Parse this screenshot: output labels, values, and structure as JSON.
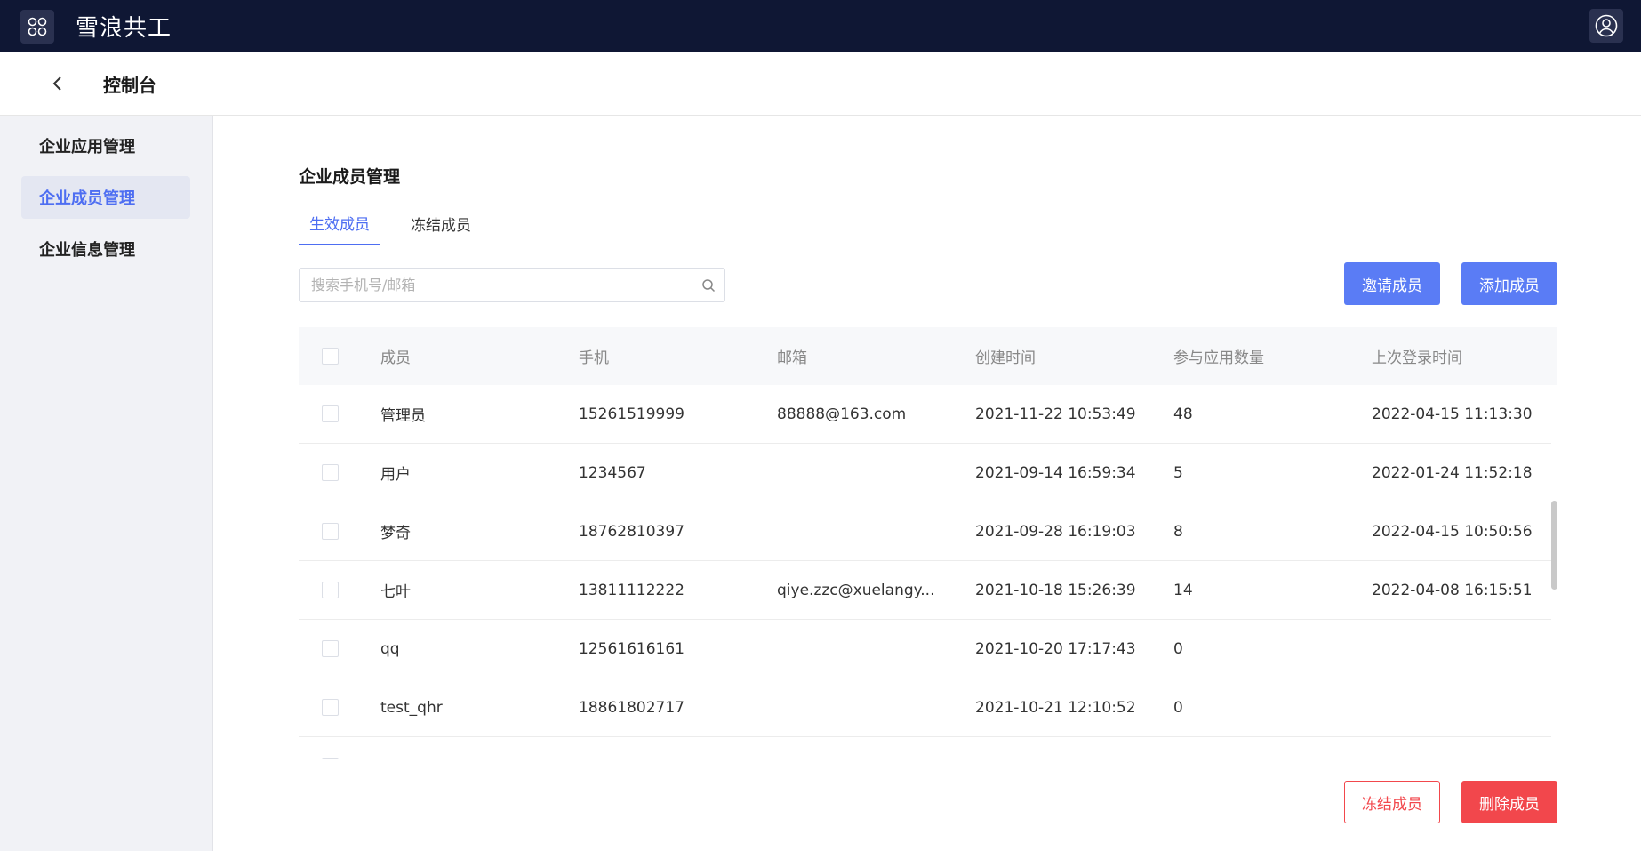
{
  "topbar": {
    "brand": "雪浪共工"
  },
  "subheader": {
    "title": "控制台"
  },
  "sidebar": {
    "items": [
      {
        "label": "企业应用管理"
      },
      {
        "label": "企业成员管理"
      },
      {
        "label": "企业信息管理"
      }
    ]
  },
  "main": {
    "title": "企业成员管理",
    "tabs": [
      {
        "label": "生效成员"
      },
      {
        "label": "冻结成员"
      }
    ],
    "search": {
      "placeholder": "搜索手机号/邮箱",
      "value": ""
    },
    "buttons": {
      "invite": "邀请成员",
      "add": "添加成员",
      "freeze": "冻结成员",
      "delete": "删除成员"
    },
    "table": {
      "columns": [
        "成员",
        "手机",
        "邮箱",
        "创建时间",
        "参与应用数量",
        "上次登录时间"
      ],
      "rows": [
        {
          "name": "管理员",
          "phone": "15261519999",
          "email": "88888@163.com",
          "created": "2021-11-22 10:53:49",
          "count": "48",
          "last_login": "2022-04-15 11:13:30"
        },
        {
          "name": "用户",
          "phone": "1234567",
          "email": "",
          "created": "2021-09-14 16:59:34",
          "count": "5",
          "last_login": "2022-01-24 11:52:18"
        },
        {
          "name": "梦奇",
          "phone": "18762810397",
          "email": "",
          "created": "2021-09-28 16:19:03",
          "count": "8",
          "last_login": "2022-04-15 10:50:56"
        },
        {
          "name": "七叶",
          "phone": "13811112222",
          "email": "qiye.zzc@xuelangy...",
          "created": "2021-10-18 15:26:39",
          "count": "14",
          "last_login": "2022-04-08 16:15:51"
        },
        {
          "name": "qq",
          "phone": "12561616161",
          "email": "",
          "created": "2021-10-20 17:17:43",
          "count": "0",
          "last_login": ""
        },
        {
          "name": "test_qhr",
          "phone": "18861802717",
          "email": "",
          "created": "2021-10-21 12:10:52",
          "count": "0",
          "last_login": ""
        }
      ]
    }
  },
  "colors": {
    "topbar": "#0f1734",
    "accent": "#4e6ef2",
    "primary_button": "#5a7cf5",
    "danger": "#f2474c",
    "sidebar_bg": "#f1f2f6"
  }
}
